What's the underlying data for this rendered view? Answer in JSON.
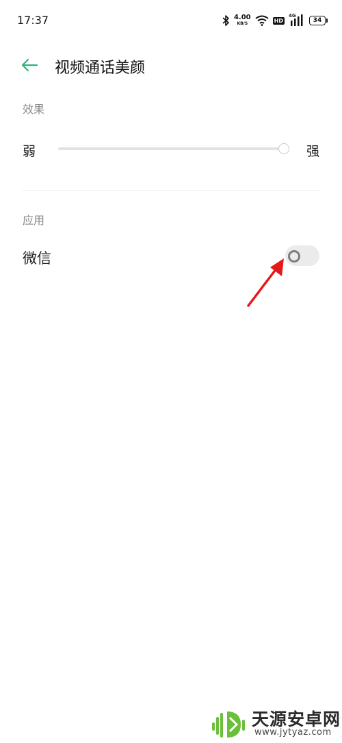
{
  "status_bar": {
    "time": "17:37",
    "net_speed_value": "4.00",
    "net_speed_unit": "KB/S",
    "hd_badge": "HD",
    "network_type": "4G",
    "battery_level": "34",
    "icons": [
      "bluetooth-icon",
      "wifi-icon",
      "hd-icon",
      "signal-icon",
      "battery-icon"
    ]
  },
  "header": {
    "title": "视频通话美颜",
    "back_icon": "back-arrow-icon",
    "accent_color": "#2fb37a"
  },
  "effect_section": {
    "label": "效果",
    "slider_min_label": "弱",
    "slider_max_label": "强",
    "slider_value_fraction": 1.0
  },
  "apps_section": {
    "label": "应用",
    "items": [
      {
        "label": "微信",
        "enabled": false
      }
    ]
  },
  "annotation": {
    "type": "arrow",
    "color": "#e5191b"
  },
  "watermark": {
    "name": "天源安卓网",
    "url": "www.jytyaz.com"
  }
}
